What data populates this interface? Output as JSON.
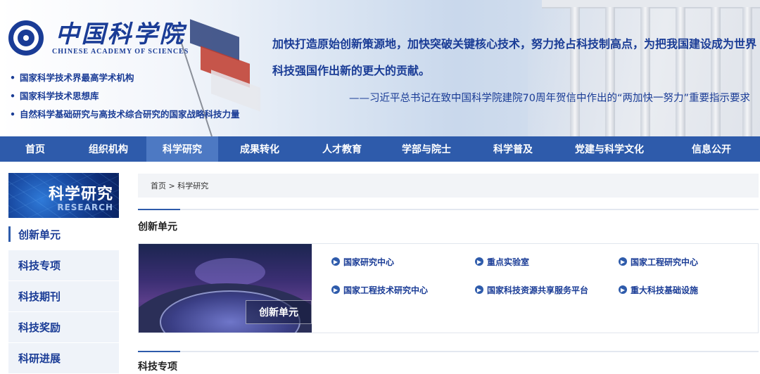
{
  "header": {
    "logo_cn": "中国科学院",
    "logo_en": "CHINESE ACADEMY OF SCIENCES",
    "bullets": [
      "国家科学技术界最高学术机构",
      "国家科学技术思想库",
      "自然科学基础研究与高技术综合研究的国家战略科技力量"
    ],
    "quote": "加快打造原始创新策源地，加快突破关键核心技术，努力抢占科技制高点，为把我国建设成为世界科技强国作出新的更大的贡献。",
    "quote_source": "——习近平总书记在致中国科学院建院70周年贺信中作出的“两加快一努力”重要指示要求"
  },
  "nav": {
    "items": [
      "首页",
      "组织机构",
      "科学研究",
      "成果转化",
      "人才教育",
      "学部与院士",
      "科学普及",
      "党建与科学文化",
      "信息公开"
    ],
    "active_index": 2
  },
  "sidebar": {
    "banner_title": "科学研究",
    "banner_subtitle": "RESEARCH",
    "items": [
      "创新单元",
      "科技专项",
      "科技期刊",
      "科技奖励",
      "科研进展"
    ],
    "active_index": 0
  },
  "breadcrumb": "首页 > 科学研究",
  "sections": {
    "innovation_title": "创新单元",
    "innovation_image_label": "创新单元",
    "innovation_links": [
      "国家研究中心",
      "重点实验室",
      "国家工程研究中心",
      "国家工程技术研究中心",
      "国家科技资源共享服务平台",
      "重大科技基础设施"
    ],
    "special_title": "科技专项"
  },
  "colors": {
    "brand_blue": "#1a3c96",
    "nav_bg": "#2e5bab",
    "nav_active": "#4d79c3"
  }
}
